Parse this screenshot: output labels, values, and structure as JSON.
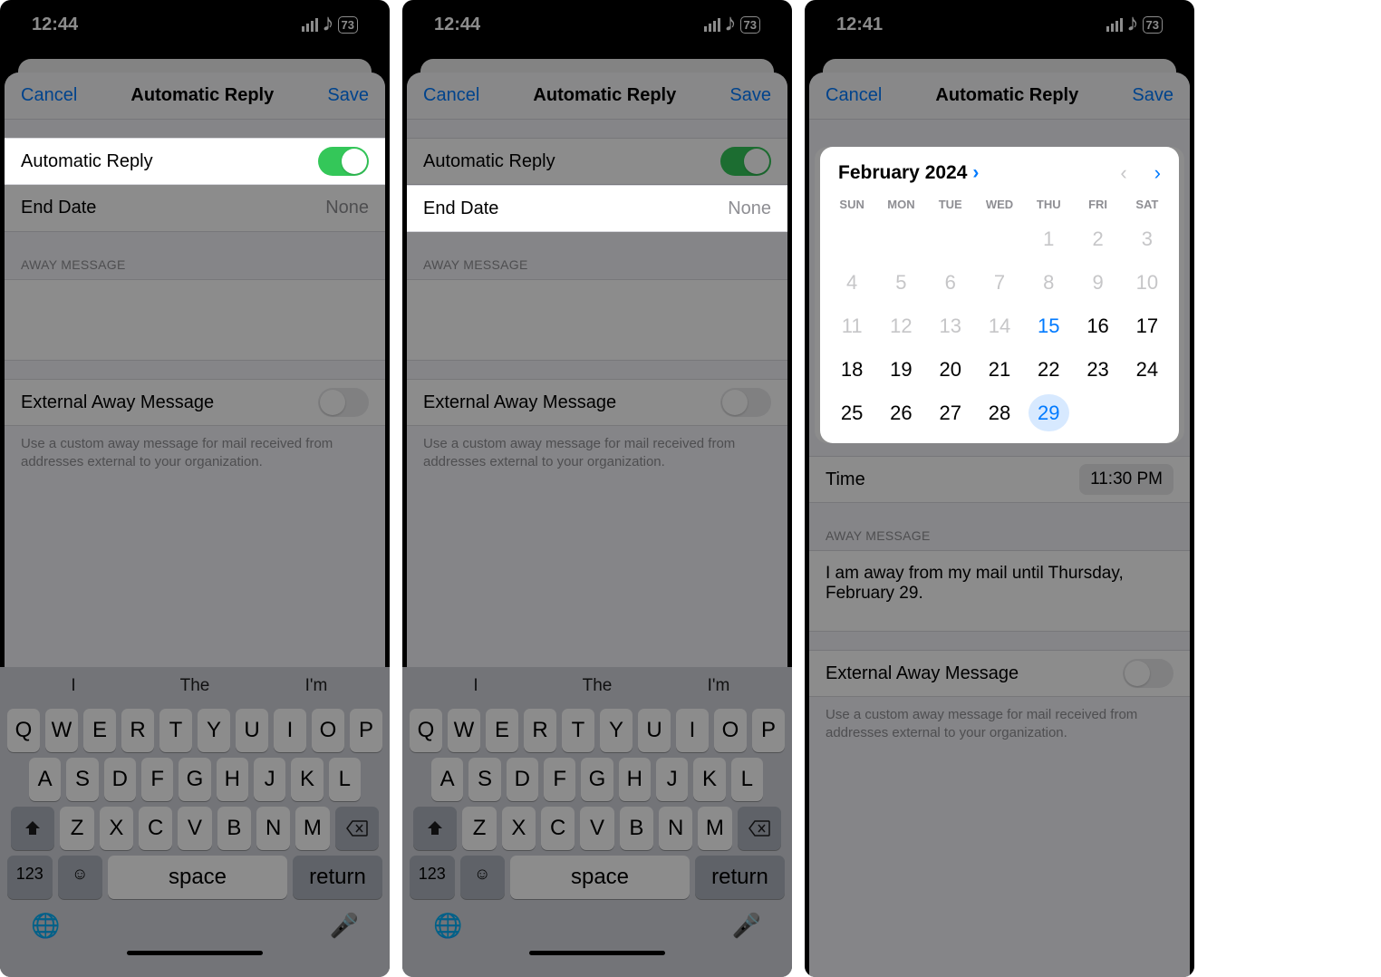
{
  "statusbar": {
    "time1": "12:44",
    "time2": "12:44",
    "time3": "12:41",
    "battery": "73"
  },
  "nav": {
    "cancel": "Cancel",
    "title": "Automatic Reply",
    "save": "Save"
  },
  "auto_reply_label": "Automatic Reply",
  "end_date_label": "End Date",
  "end_date_value": "None",
  "away_header": "AWAY MESSAGE",
  "external_label": "External Away Message",
  "external_note": "Use a custom away message for mail received from addresses external to your organization.",
  "predict": [
    "I",
    "The",
    "I'm"
  ],
  "kb": {
    "row1": [
      "Q",
      "W",
      "E",
      "R",
      "T",
      "Y",
      "U",
      "I",
      "O",
      "P"
    ],
    "row2": [
      "A",
      "S",
      "D",
      "F",
      "G",
      "H",
      "J",
      "K",
      "L"
    ],
    "row3": [
      "Z",
      "X",
      "C",
      "V",
      "B",
      "N",
      "M"
    ],
    "numkey": "123",
    "space": "space",
    "return": "return"
  },
  "calendar": {
    "month": "February 2024",
    "weekdays": [
      "SUN",
      "MON",
      "TUE",
      "WED",
      "THU",
      "FRI",
      "SAT"
    ],
    "days": [
      {
        "d": "",
        "cls": "disabled"
      },
      {
        "d": "",
        "cls": "disabled"
      },
      {
        "d": "",
        "cls": "disabled"
      },
      {
        "d": "",
        "cls": "disabled"
      },
      {
        "d": "1",
        "cls": "disabled"
      },
      {
        "d": "2",
        "cls": "disabled"
      },
      {
        "d": "3",
        "cls": "disabled"
      },
      {
        "d": "4",
        "cls": "disabled"
      },
      {
        "d": "5",
        "cls": "disabled"
      },
      {
        "d": "6",
        "cls": "disabled"
      },
      {
        "d": "7",
        "cls": "disabled"
      },
      {
        "d": "8",
        "cls": "disabled"
      },
      {
        "d": "9",
        "cls": "disabled"
      },
      {
        "d": "10",
        "cls": "disabled"
      },
      {
        "d": "11",
        "cls": "disabled"
      },
      {
        "d": "12",
        "cls": "disabled"
      },
      {
        "d": "13",
        "cls": "disabled"
      },
      {
        "d": "14",
        "cls": "disabled"
      },
      {
        "d": "15",
        "cls": "today"
      },
      {
        "d": "16",
        "cls": ""
      },
      {
        "d": "17",
        "cls": ""
      },
      {
        "d": "18",
        "cls": ""
      },
      {
        "d": "19",
        "cls": ""
      },
      {
        "d": "20",
        "cls": ""
      },
      {
        "d": "21",
        "cls": ""
      },
      {
        "d": "22",
        "cls": ""
      },
      {
        "d": "23",
        "cls": ""
      },
      {
        "d": "24",
        "cls": ""
      },
      {
        "d": "25",
        "cls": ""
      },
      {
        "d": "26",
        "cls": ""
      },
      {
        "d": "27",
        "cls": ""
      },
      {
        "d": "28",
        "cls": ""
      },
      {
        "d": "29",
        "cls": "selected"
      }
    ]
  },
  "time_row": {
    "label": "Time",
    "value": "11:30 PM"
  },
  "away_text": "I am away from my mail until Thursday, February 29."
}
